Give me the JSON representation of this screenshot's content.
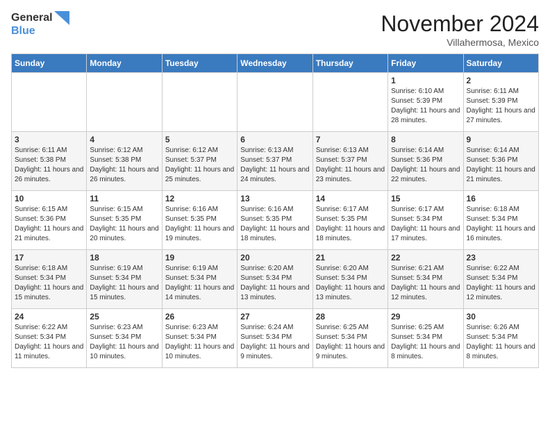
{
  "logo": {
    "general": "General",
    "blue": "Blue"
  },
  "title": "November 2024",
  "subtitle": "Villahermosa, Mexico",
  "days_of_week": [
    "Sunday",
    "Monday",
    "Tuesday",
    "Wednesday",
    "Thursday",
    "Friday",
    "Saturday"
  ],
  "weeks": [
    [
      {
        "day": "",
        "info": ""
      },
      {
        "day": "",
        "info": ""
      },
      {
        "day": "",
        "info": ""
      },
      {
        "day": "",
        "info": ""
      },
      {
        "day": "",
        "info": ""
      },
      {
        "day": "1",
        "info": "Sunrise: 6:10 AM\nSunset: 5:39 PM\nDaylight: 11 hours and 28 minutes."
      },
      {
        "day": "2",
        "info": "Sunrise: 6:11 AM\nSunset: 5:39 PM\nDaylight: 11 hours and 27 minutes."
      }
    ],
    [
      {
        "day": "3",
        "info": "Sunrise: 6:11 AM\nSunset: 5:38 PM\nDaylight: 11 hours and 26 minutes."
      },
      {
        "day": "4",
        "info": "Sunrise: 6:12 AM\nSunset: 5:38 PM\nDaylight: 11 hours and 26 minutes."
      },
      {
        "day": "5",
        "info": "Sunrise: 6:12 AM\nSunset: 5:37 PM\nDaylight: 11 hours and 25 minutes."
      },
      {
        "day": "6",
        "info": "Sunrise: 6:13 AM\nSunset: 5:37 PM\nDaylight: 11 hours and 24 minutes."
      },
      {
        "day": "7",
        "info": "Sunrise: 6:13 AM\nSunset: 5:37 PM\nDaylight: 11 hours and 23 minutes."
      },
      {
        "day": "8",
        "info": "Sunrise: 6:14 AM\nSunset: 5:36 PM\nDaylight: 11 hours and 22 minutes."
      },
      {
        "day": "9",
        "info": "Sunrise: 6:14 AM\nSunset: 5:36 PM\nDaylight: 11 hours and 21 minutes."
      }
    ],
    [
      {
        "day": "10",
        "info": "Sunrise: 6:15 AM\nSunset: 5:36 PM\nDaylight: 11 hours and 21 minutes."
      },
      {
        "day": "11",
        "info": "Sunrise: 6:15 AM\nSunset: 5:35 PM\nDaylight: 11 hours and 20 minutes."
      },
      {
        "day": "12",
        "info": "Sunrise: 6:16 AM\nSunset: 5:35 PM\nDaylight: 11 hours and 19 minutes."
      },
      {
        "day": "13",
        "info": "Sunrise: 6:16 AM\nSunset: 5:35 PM\nDaylight: 11 hours and 18 minutes."
      },
      {
        "day": "14",
        "info": "Sunrise: 6:17 AM\nSunset: 5:35 PM\nDaylight: 11 hours and 18 minutes."
      },
      {
        "day": "15",
        "info": "Sunrise: 6:17 AM\nSunset: 5:34 PM\nDaylight: 11 hours and 17 minutes."
      },
      {
        "day": "16",
        "info": "Sunrise: 6:18 AM\nSunset: 5:34 PM\nDaylight: 11 hours and 16 minutes."
      }
    ],
    [
      {
        "day": "17",
        "info": "Sunrise: 6:18 AM\nSunset: 5:34 PM\nDaylight: 11 hours and 15 minutes."
      },
      {
        "day": "18",
        "info": "Sunrise: 6:19 AM\nSunset: 5:34 PM\nDaylight: 11 hours and 15 minutes."
      },
      {
        "day": "19",
        "info": "Sunrise: 6:19 AM\nSunset: 5:34 PM\nDaylight: 11 hours and 14 minutes."
      },
      {
        "day": "20",
        "info": "Sunrise: 6:20 AM\nSunset: 5:34 PM\nDaylight: 11 hours and 13 minutes."
      },
      {
        "day": "21",
        "info": "Sunrise: 6:20 AM\nSunset: 5:34 PM\nDaylight: 11 hours and 13 minutes."
      },
      {
        "day": "22",
        "info": "Sunrise: 6:21 AM\nSunset: 5:34 PM\nDaylight: 11 hours and 12 minutes."
      },
      {
        "day": "23",
        "info": "Sunrise: 6:22 AM\nSunset: 5:34 PM\nDaylight: 11 hours and 12 minutes."
      }
    ],
    [
      {
        "day": "24",
        "info": "Sunrise: 6:22 AM\nSunset: 5:34 PM\nDaylight: 11 hours and 11 minutes."
      },
      {
        "day": "25",
        "info": "Sunrise: 6:23 AM\nSunset: 5:34 PM\nDaylight: 11 hours and 10 minutes."
      },
      {
        "day": "26",
        "info": "Sunrise: 6:23 AM\nSunset: 5:34 PM\nDaylight: 11 hours and 10 minutes."
      },
      {
        "day": "27",
        "info": "Sunrise: 6:24 AM\nSunset: 5:34 PM\nDaylight: 11 hours and 9 minutes."
      },
      {
        "day": "28",
        "info": "Sunrise: 6:25 AM\nSunset: 5:34 PM\nDaylight: 11 hours and 9 minutes."
      },
      {
        "day": "29",
        "info": "Sunrise: 6:25 AM\nSunset: 5:34 PM\nDaylight: 11 hours and 8 minutes."
      },
      {
        "day": "30",
        "info": "Sunrise: 6:26 AM\nSunset: 5:34 PM\nDaylight: 11 hours and 8 minutes."
      }
    ]
  ]
}
